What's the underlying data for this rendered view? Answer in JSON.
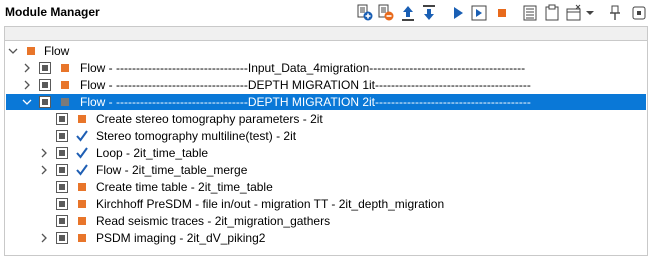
{
  "panel": {
    "title": "Module Manager"
  },
  "toolbar": {
    "icons": [
      "add-module-icon",
      "remove-module-icon",
      "move-up-icon",
      "move-down-icon",
      "run-icon",
      "run-step-icon",
      "stop-icon",
      "list-view-icon",
      "clipboard-icon",
      "window-options-icon",
      "dropdown-icon",
      "pin-icon",
      "close-panel-icon"
    ]
  },
  "tree": {
    "root": {
      "label": "Flow"
    },
    "items": [
      {
        "label": "Flow - ---------------------------------Input_Data_4migration---------------------------------------",
        "status": "orange"
      },
      {
        "label": "Flow - ---------------------------------DEPTH MIGRATION 1it---------------------------------------",
        "status": "orange"
      },
      {
        "label": "Flow - ---------------------------------DEPTH MIGRATION 2it---------------------------------------",
        "status": "grey",
        "selected": true
      },
      {
        "label": "Create stereo tomography parameters - 2it",
        "status": "orange"
      },
      {
        "label": "Stereo tomography multiline(test) - 2it",
        "status": "check"
      },
      {
        "label": "Loop - 2it_time_table",
        "status": "check"
      },
      {
        "label": "Flow - 2it_time_table_merge",
        "status": "check"
      },
      {
        "label": "Create time table - 2it_time_table",
        "status": "orange"
      },
      {
        "label": "Kirchhoff PreSDM - file in/out - migration TT - 2it_depth_migration",
        "status": "orange"
      },
      {
        "label": "Read seismic traces - 2it_migration_gathers",
        "status": "orange"
      },
      {
        "label": "PSDM imaging - 2it_dV_piking2",
        "status": "orange"
      }
    ]
  },
  "colors": {
    "selection": "#0a78d7",
    "status_orange": "#e8752a",
    "check_blue": "#1f5fb4",
    "toolbar_blue": "#1a5fb4",
    "stop_orange": "#e86a1c"
  }
}
